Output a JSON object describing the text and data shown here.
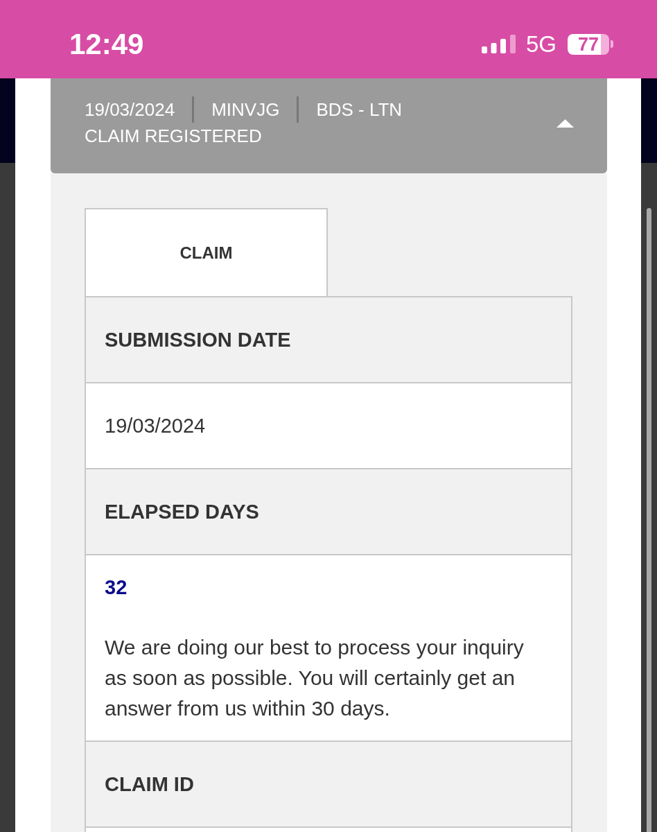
{
  "status_bar": {
    "time": "12:49",
    "network": "5G",
    "battery": "77"
  },
  "claim_header": {
    "date": "19/03/2024",
    "reference": "MINVJG",
    "route": "BDS - LTN",
    "status": "CLAIM REGISTERED",
    "expanded": true
  },
  "tabs": [
    {
      "label": "CLAIM",
      "selected": true
    }
  ],
  "details": [
    {
      "kind": "label",
      "text": "SUBMISSION DATE"
    },
    {
      "kind": "value",
      "text": "19/03/2024"
    },
    {
      "kind": "label",
      "text": "ELAPSED DAYS"
    },
    {
      "kind": "count",
      "text": "32",
      "note": "We are doing our best to process your inquiry as soon as possible. You will certainly get an answer from us within 30 days."
    },
    {
      "kind": "label",
      "text": "CLAIM ID"
    },
    {
      "kind": "value"
    }
  ]
}
